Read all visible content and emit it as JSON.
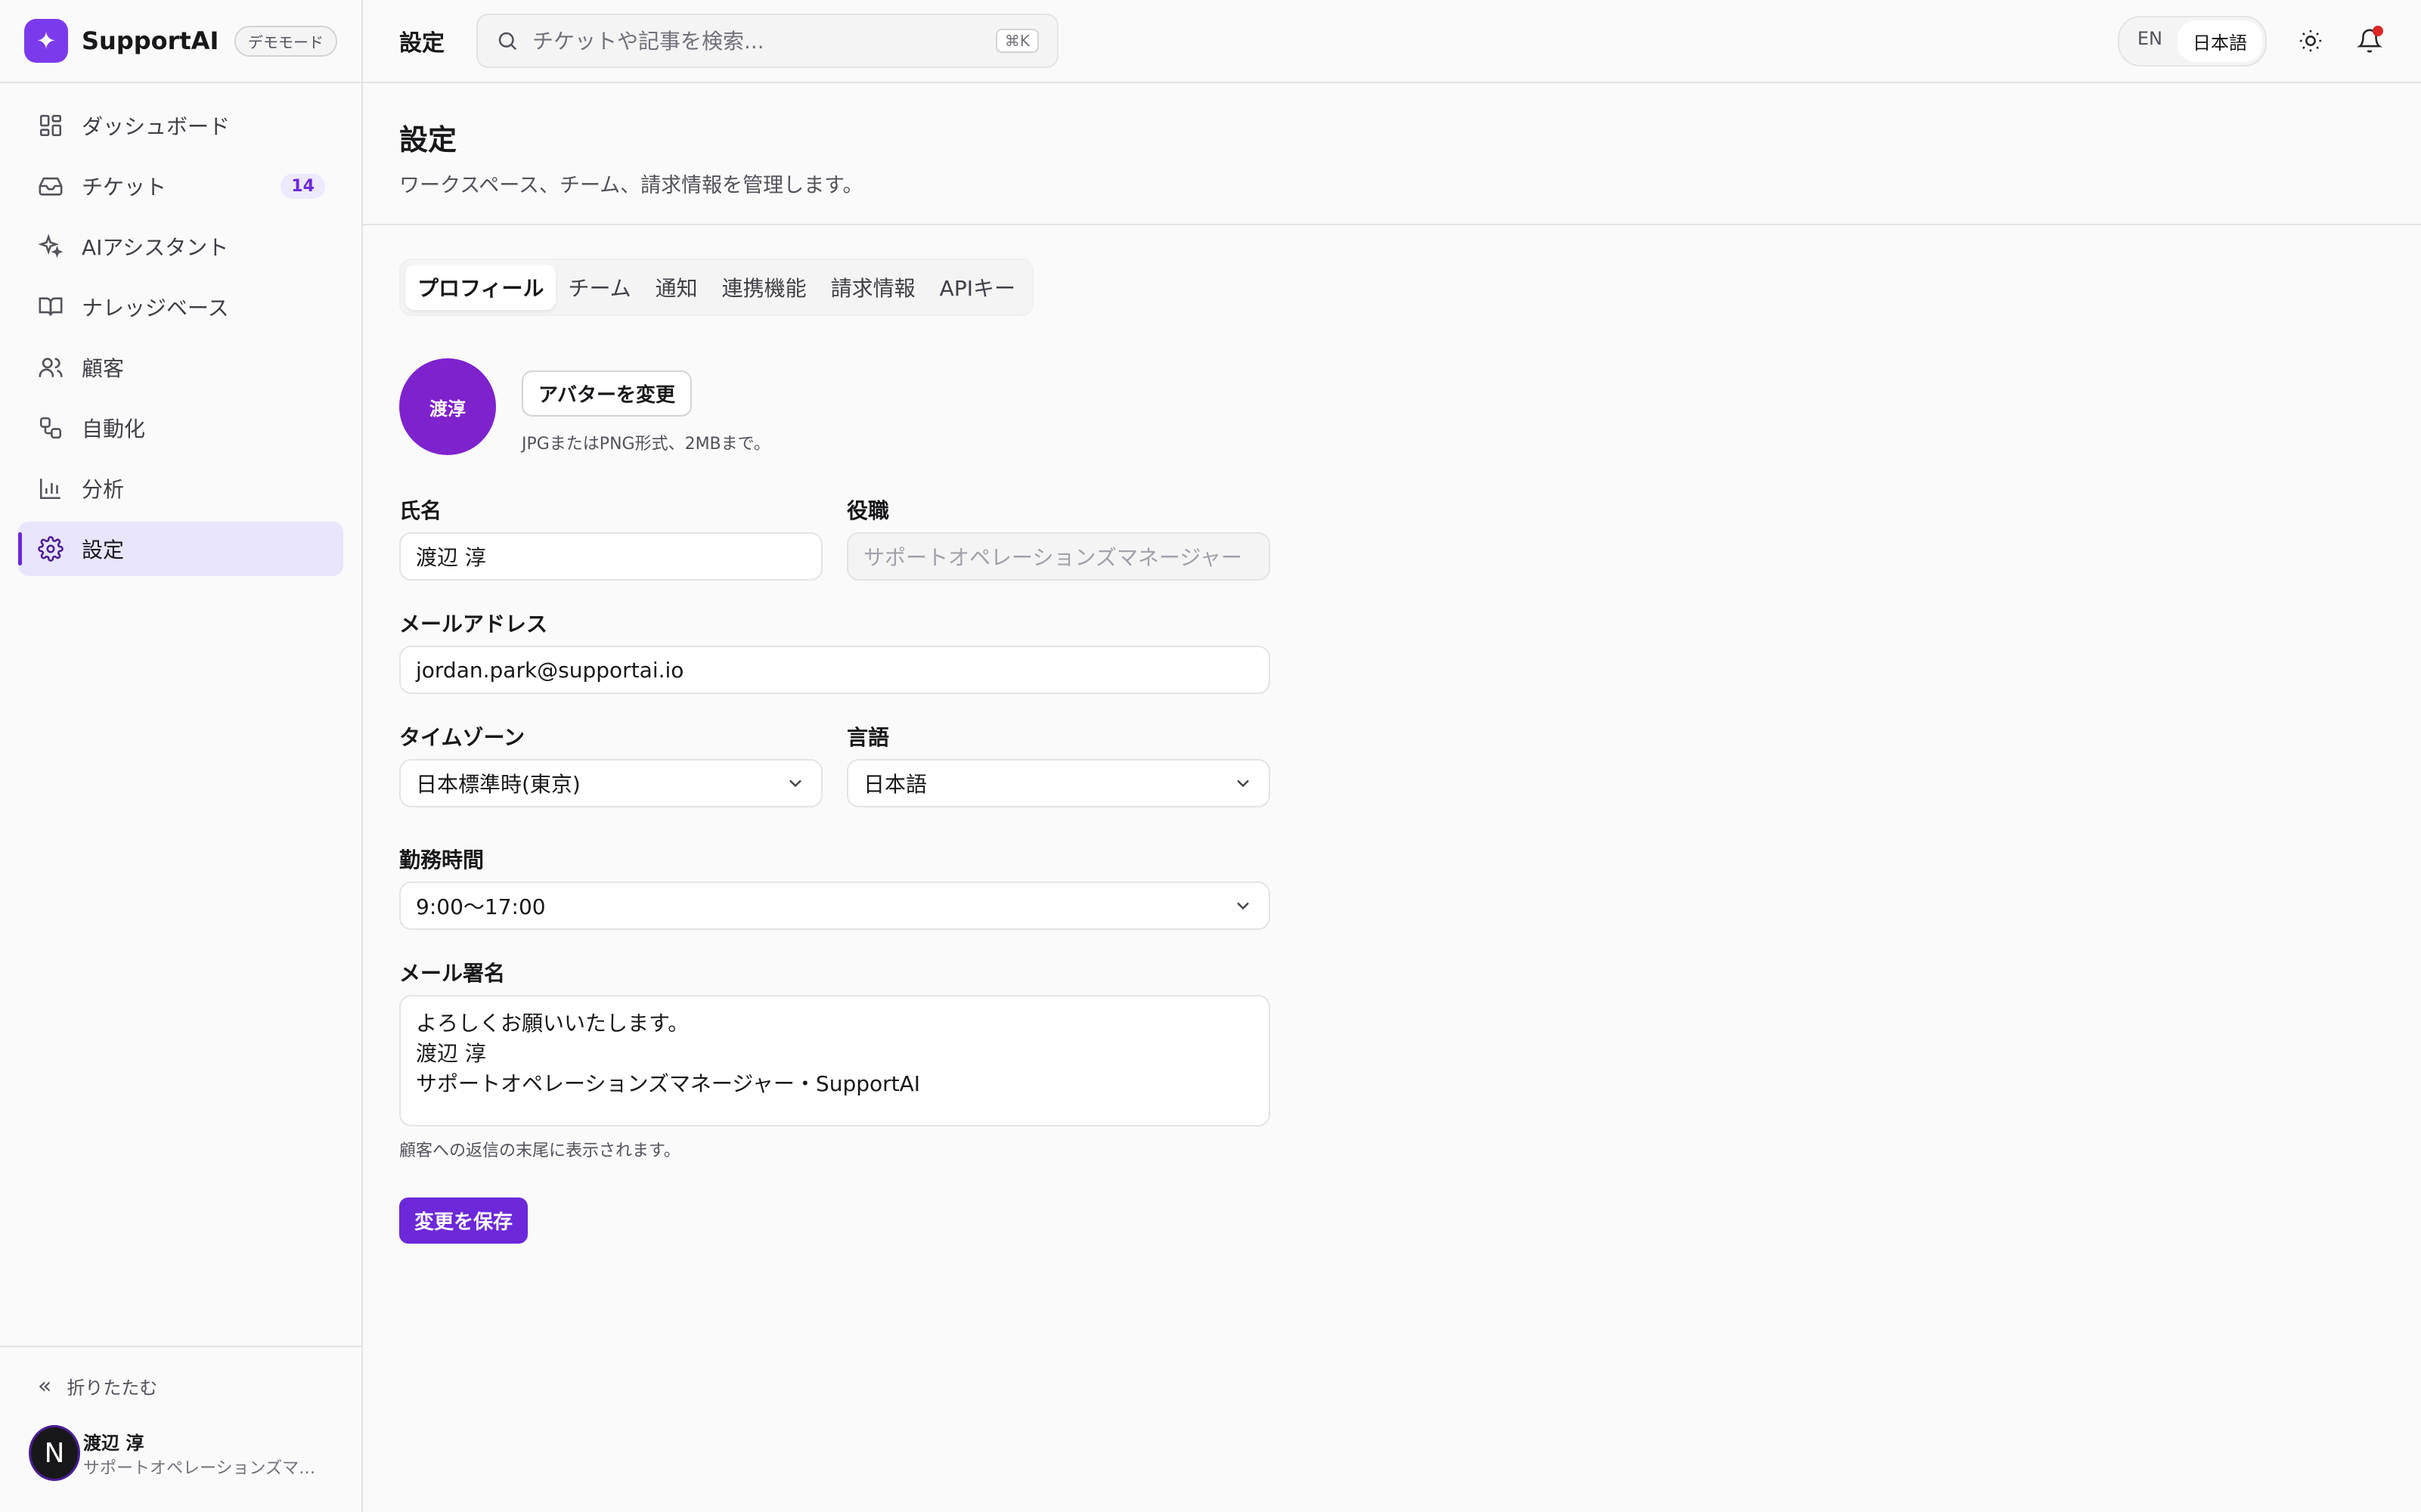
{
  "brand": {
    "name": "SupportAI",
    "badge": "デモモード",
    "logo_glyph": "✦"
  },
  "sidebar": {
    "items": [
      {
        "label": "ダッシュボード",
        "icon": "dashboard-icon"
      },
      {
        "label": "チケット",
        "icon": "inbox-icon",
        "count": "14"
      },
      {
        "label": "AIアシスタント",
        "icon": "sparkles-icon"
      },
      {
        "label": "ナレッジベース",
        "icon": "book-icon"
      },
      {
        "label": "顧客",
        "icon": "users-icon"
      },
      {
        "label": "自動化",
        "icon": "workflow-icon"
      },
      {
        "label": "分析",
        "icon": "chart-icon"
      },
      {
        "label": "設定",
        "icon": "gear-icon",
        "active": true
      }
    ],
    "collapse_label": "折りたたむ",
    "user": {
      "initial": "N",
      "name": "渡辺 淳",
      "role": "サポートオペレーションズマ…"
    }
  },
  "topbar": {
    "title": "設定",
    "search_placeholder": "チケットや記事を検索...",
    "shortcut": "⌘K",
    "lang_en": "EN",
    "lang_ja": "日本語"
  },
  "page": {
    "title": "設定",
    "subtitle": "ワークスペース、チーム、請求情報を管理します。"
  },
  "tabs": [
    "プロフィール",
    "チーム",
    "通知",
    "連携機能",
    "請求情報",
    "APIキー"
  ],
  "profile": {
    "avatar_text": "渡淳",
    "change_avatar": "アバターを変更",
    "avatar_hint": "JPGまたはPNG形式、2MBまで。",
    "name_label": "氏名",
    "name_value": "渡辺 淳",
    "role_label": "役職",
    "role_value": "サポートオペレーションズマネージャー",
    "email_label": "メールアドレス",
    "email_value": "jordan.park@supportai.io",
    "timezone_label": "タイムゾーン",
    "timezone_value": "日本標準時(東京)",
    "language_label": "言語",
    "language_value": "日本語",
    "hours_label": "勤務時間",
    "hours_value": "9:00〜17:00",
    "signature_label": "メール署名",
    "signature_lines": [
      "よろしくお願いいたします。",
      "渡辺 淳",
      "サポートオペレーションズマネージャー・SupportAI"
    ],
    "signature_hint": "顧客への返信の末尾に表示されます。",
    "save_label": "変更を保存"
  },
  "colors": {
    "accent": "#6d28d9",
    "avatar": "#7e22ce",
    "notification": "#dc2626"
  }
}
